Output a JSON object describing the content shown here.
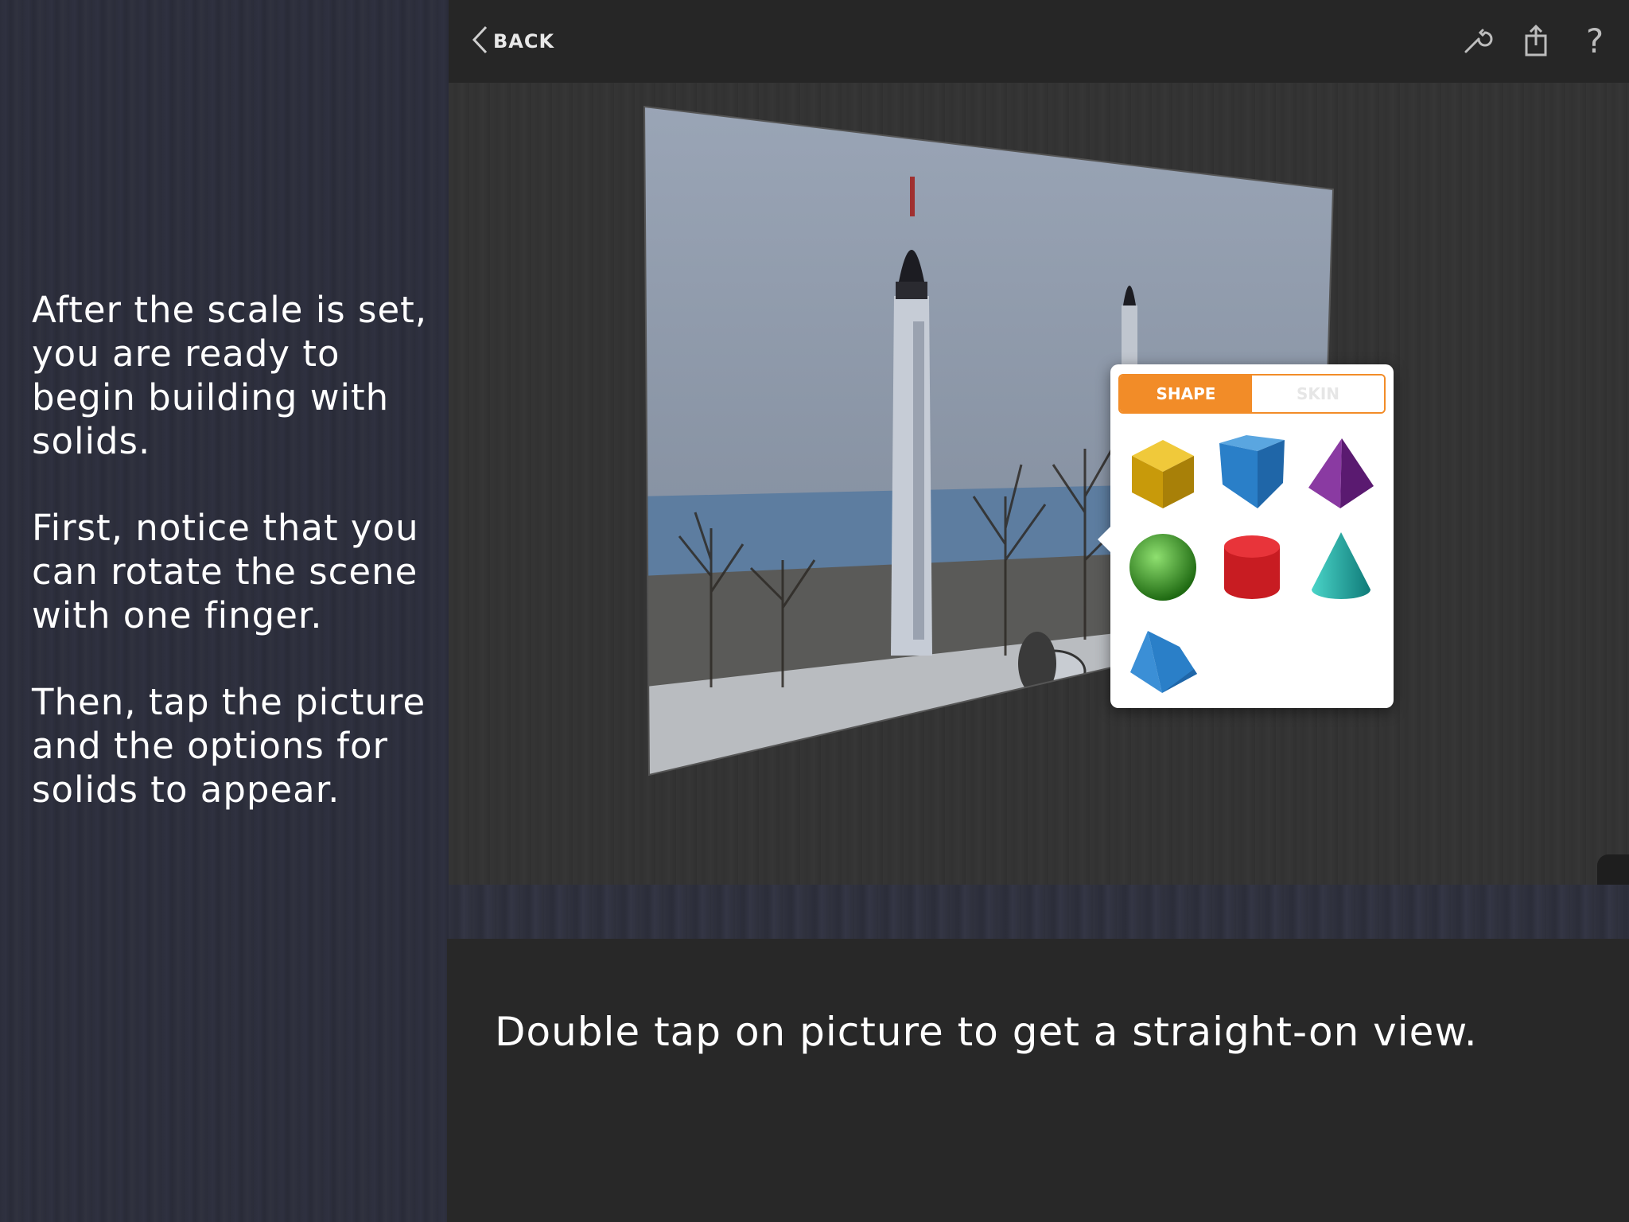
{
  "instructions": {
    "paragraphs": [
      "After the scale is set, you are ready to begin building with solids.",
      "First, notice that you can rotate the scene with one finger.",
      "Then, tap the picture and the options for solids to appear."
    ]
  },
  "app": {
    "topbar": {
      "back_label": "BACK",
      "icons": [
        "wrench-icon",
        "share-icon",
        "help-icon"
      ],
      "help_glyph": "?"
    },
    "solids_popup": {
      "tabs": [
        {
          "label": "SHAPE",
          "active": true
        },
        {
          "label": "SKIN",
          "active": false
        }
      ],
      "shapes": [
        "cube",
        "prism",
        "pyramid",
        "sphere",
        "cylinder",
        "cone",
        "triangular-prism"
      ],
      "colors": {
        "cube": "#d8b00a",
        "prism": "#2a7fc8",
        "pyramid": "#6a2380",
        "sphere": "#3fa02a",
        "cylinder": "#c81c22",
        "cone": "#1fa8a2",
        "triangular-prism": "#2a7fc8"
      }
    }
  },
  "caption": {
    "text": "Double tap on picture to get a straight-on view."
  },
  "colors": {
    "accent": "#f28c28"
  }
}
